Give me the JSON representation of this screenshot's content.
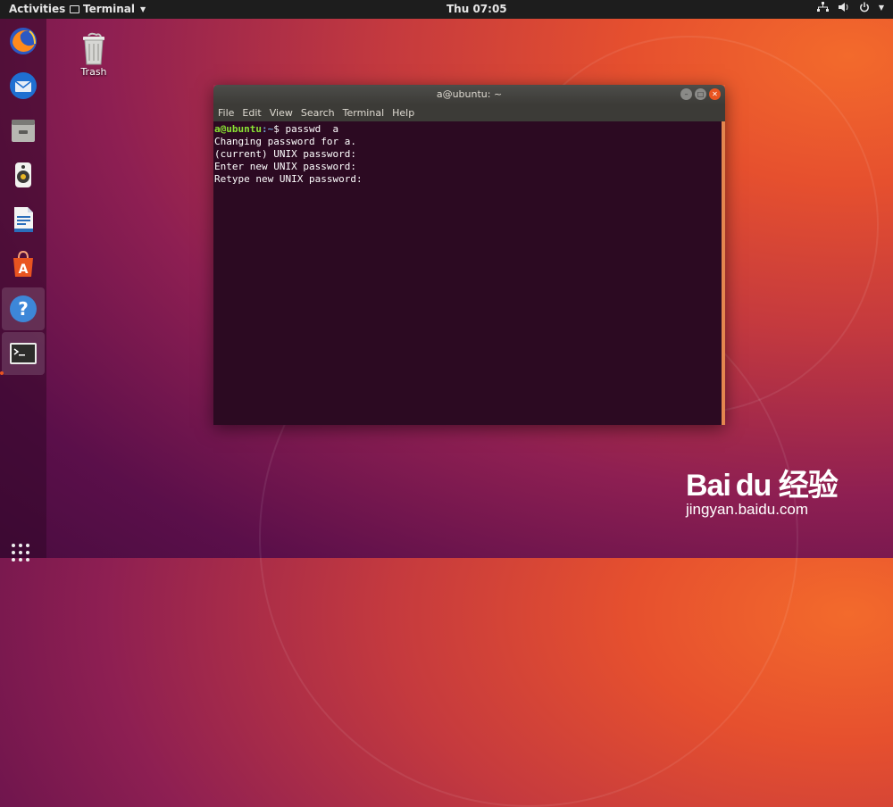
{
  "topbar": {
    "activities": "Activities",
    "app_name": "Terminal",
    "clock": "Thu 07:05",
    "tray_icons": [
      "network-icon",
      "volume-icon",
      "power-icon"
    ]
  },
  "dock": {
    "items": [
      "firefox-icon",
      "thunderbird-icon",
      "files-icon",
      "rhythmbox-icon",
      "libreoffice-writer-icon",
      "software-center-icon",
      "help-icon",
      "terminal-icon"
    ],
    "active_item": "terminal-icon"
  },
  "desktop": {
    "trash_label": "Trash"
  },
  "window": {
    "title": "a@ubuntu: ~",
    "menu": [
      "File",
      "Edit",
      "View",
      "Search",
      "Terminal",
      "Help"
    ],
    "prompt_user": "a@ubuntu",
    "prompt_path": ":~",
    "prompt_symbol": "$ ",
    "command": "passwd  a",
    "output": [
      "Changing password for a.",
      "(current) UNIX password:",
      "Enter new UNIX password:",
      "Retype new UNIX password:"
    ]
  },
  "watermark": {
    "logo": "Bai du 经验",
    "url": "jingyan.baidu.com"
  },
  "colors": {
    "accent": "#e95420",
    "terminal_bg": "#2c0a22",
    "prompt_user": "#8ae234"
  }
}
